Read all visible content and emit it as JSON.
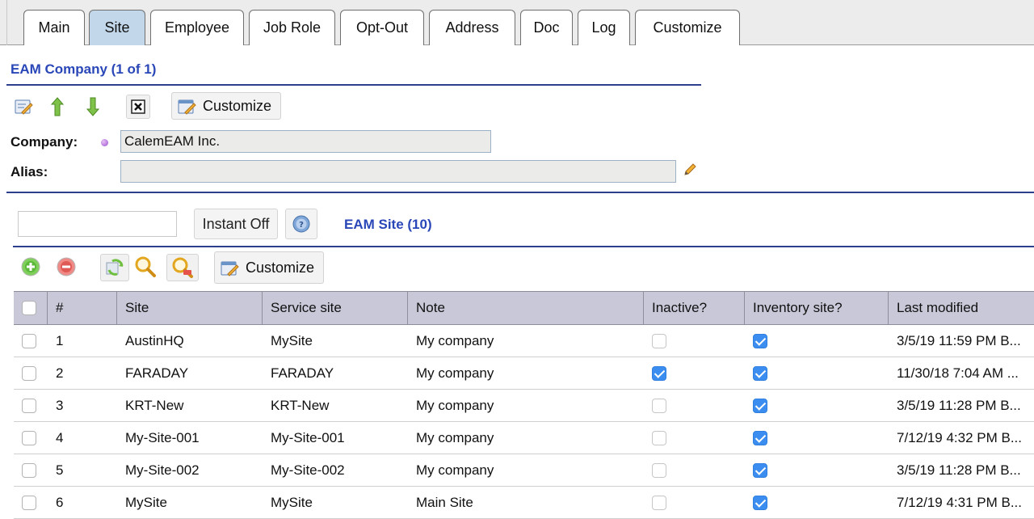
{
  "tabs": [
    {
      "label": "Main",
      "active": false
    },
    {
      "label": "Site",
      "active": true
    },
    {
      "label": "Employee",
      "active": false
    },
    {
      "label": "Job Role",
      "active": false
    },
    {
      "label": "Opt-Out",
      "active": false
    },
    {
      "label": "Address",
      "active": false
    },
    {
      "label": "Doc",
      "active": false
    },
    {
      "label": "Log",
      "active": false
    },
    {
      "label": "Customize",
      "active": false
    }
  ],
  "company": {
    "section_title": "EAM Company (1 of 1)",
    "customize_label": "Customize",
    "company_label": "Company:",
    "company_value": "CalemEAM Inc.",
    "alias_label": "Alias:",
    "alias_value": ""
  },
  "sites": {
    "search_value": "",
    "instant_label": "Instant Off",
    "section_title": "EAM Site (10)",
    "customize_label": "Customize",
    "columns": [
      "#",
      "Site",
      "Service site",
      "Note",
      "Inactive?",
      "Inventory site?",
      "Last modified"
    ],
    "rows": [
      {
        "num": "1",
        "site": "AustinHQ",
        "service_site": "MySite",
        "note": "My company",
        "inactive": false,
        "inventory": true,
        "modified": "3/5/19 11:59 PM B..."
      },
      {
        "num": "2",
        "site": "FARADAY",
        "service_site": "FARADAY",
        "note": "My company",
        "inactive": true,
        "inventory": true,
        "modified": "11/30/18 7:04 AM ..."
      },
      {
        "num": "3",
        "site": "KRT-New",
        "service_site": "KRT-New",
        "note": "My company",
        "inactive": false,
        "inventory": true,
        "modified": "3/5/19 11:28 PM B..."
      },
      {
        "num": "4",
        "site": "My-Site-001",
        "service_site": "My-Site-001",
        "note": "My company",
        "inactive": false,
        "inventory": true,
        "modified": "7/12/19 4:32 PM B..."
      },
      {
        "num": "5",
        "site": "My-Site-002",
        "service_site": "My-Site-002",
        "note": "My company",
        "inactive": false,
        "inventory": true,
        "modified": "3/5/19 11:28 PM B..."
      },
      {
        "num": "6",
        "site": "MySite",
        "service_site": "MySite",
        "note": "Main Site",
        "inactive": false,
        "inventory": true,
        "modified": "7/12/19 4:31 PM B..."
      }
    ]
  },
  "colors": {
    "accent_blue": "#2a47b8",
    "active_tab": "#c2d8ea",
    "grid_header": "#c8c8d9",
    "checkbox_checked": "#3b8ef0"
  }
}
